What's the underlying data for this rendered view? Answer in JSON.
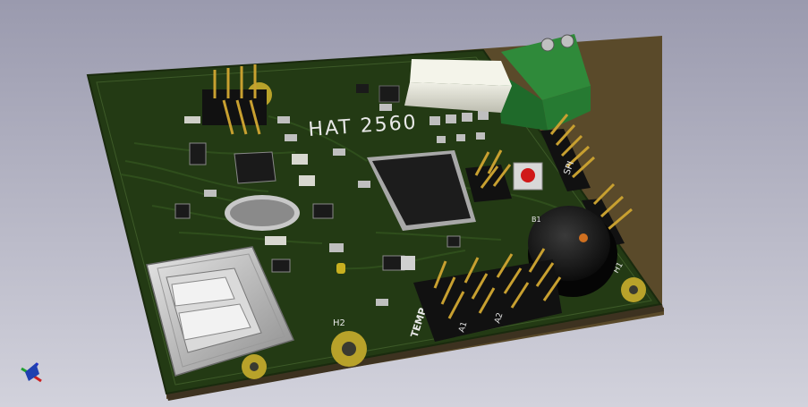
{
  "viewer": {
    "background_top": "#9a9aae",
    "background_bottom": "#d2d2dc"
  },
  "board": {
    "title": "HAT 2560",
    "solder_mask_color": "#233a14",
    "silkscreen_color": "#e8e8e8",
    "labels": {
      "spi": "SPI",
      "temp": "TEMP",
      "h1": "H1",
      "h2": "H2",
      "b1": "B1",
      "a1": "A1",
      "a2": "A2"
    }
  },
  "components": {
    "usb": "usb-a-connector",
    "terminal": "green-screw-terminal",
    "buzzer": "round-buzzer",
    "crystal": "crystal-oscillator",
    "mcu": "tqfp-100-mcu",
    "button": "red-tactile-button"
  },
  "axis_gizmo": "xyz-axis-icon"
}
